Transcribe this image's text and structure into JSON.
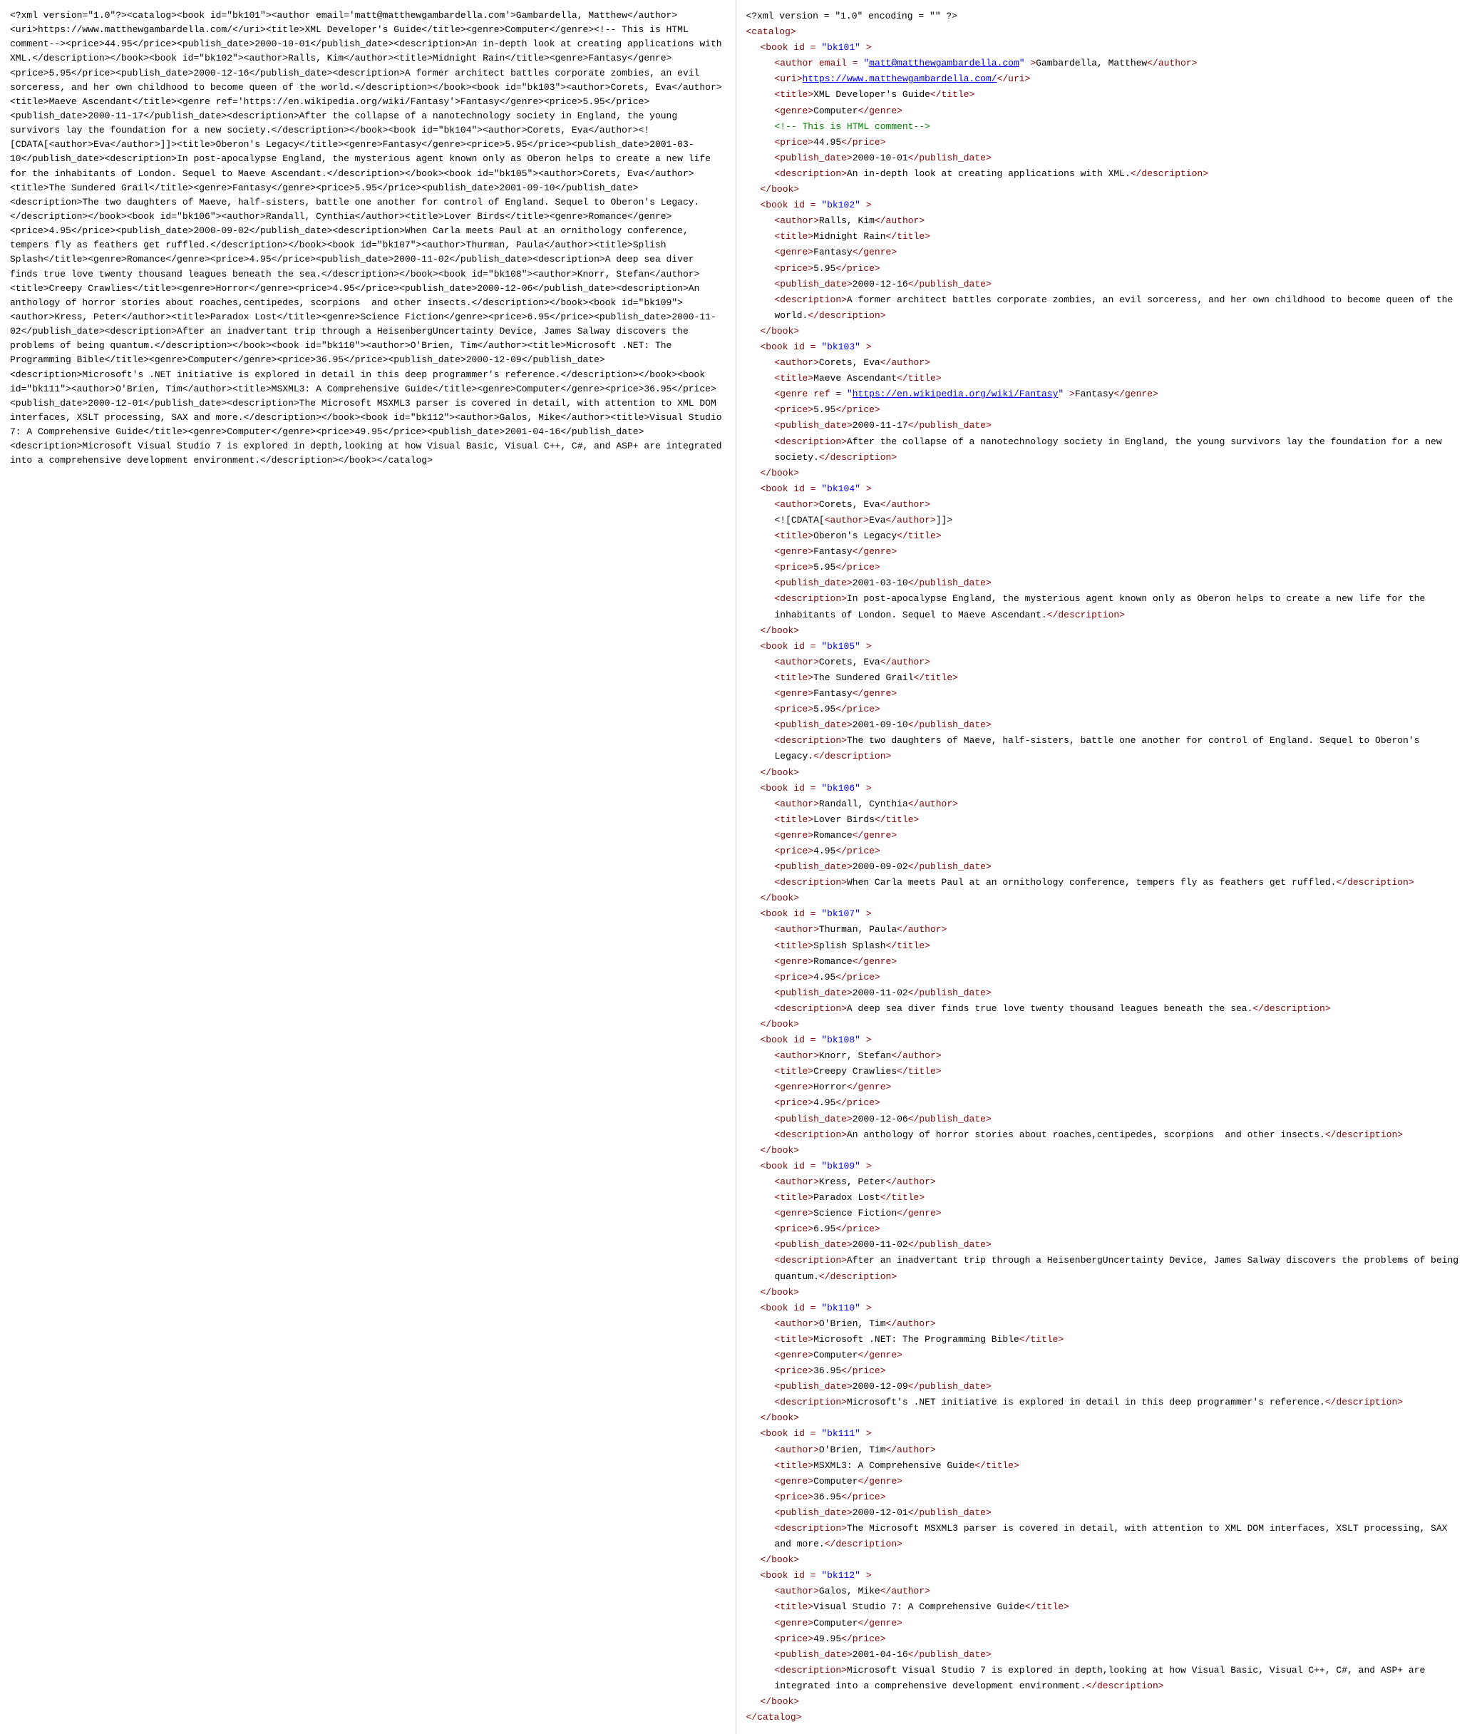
{
  "left_panel": {
    "content": "<?xml version=\"1.0\"?><catalog><book id=\"bk101\"><author email='matt@matthewgambardella.com'>Gambardella, Matthew</author><uri>https://www.matthewgambardella.com/</uri><title>XML Developer's Guide</title><genre>Computer</genre><!-- This is HTML comment--><price>44.95</price><publish_date>2000-10-01</publish_date><description>An in-depth look at creating applications with XML.</description></book><book id=\"bk102\"><author>Ralls, Kim</author><title>Midnight Rain</title><genre>Fantasy</genre><price>5.95</price><publish_date>2000-12-16</publish_date><description>A former architect battles corporate zombies, an evil sorceress, and her own childhood to become queen of the world.</description></book><book id=\"bk103\"><author>Corets, Eva</author><title>Maeve Ascendant</title><genre ref='https://en.wikipedia.org/wiki/Fantasy'>Fantasy</genre><price>5.95</price><publish_date>2000-11-17</publish_date><description>After the collapse of a nanotechnology society in England, the young survivors lay the foundation for a new society.</description></book><book id=\"bk104\"><author>Corets, Eva</author><![CDATA[<author>Eva</author>]]><title>Oberon's Legacy</title><genre>Fantasy</genre><price>5.95</price><publish_date>2001-03-10</publish_date><description>In post-apocalypse England, the mysterious agent known only as Oberon helps to create a new life for the inhabitants of London. Sequel to Maeve Ascendant.</description></book><book id=\"bk105\"><author>Corets, Eva</author><title>The Sundered Grail</title><genre>Fantasy</genre><price>5.95</price><publish_date>2001-09-10</publish_date><description>The two daughters of Maeve, half-sisters, battle one another for control of England. Sequel to Oberon's Legacy.</description></book><book id=\"bk106\"><author>Randall, Cynthia</author><title>Lover Birds</title><genre>Romance</genre><price>4.95</price><publish_date>2000-09-02</publish_date><description>When Carla meets Paul at an ornithology conference, tempers fly as feathers get ruffled.</description></book><book id=\"bk107\"><author>Thurman, Paula</author><title>Splish Splash</title><genre>Romance</genre><price>4.95</price><publish_date>2000-11-02</publish_date><description>A deep sea diver finds true love twenty thousand leagues beneath the sea.</description></book><book id=\"bk108\"><author>Knorr, Stefan</author><title>Creepy Crawlies</title><genre>Horror</genre><price>4.95</price><publish_date>2000-12-06</publish_date><description>An anthology of horror stories about roaches,centipedes, scorpions  and other insects.</description></book><book id=\"bk109\"><author>Kress, Peter</author><title>Paradox Lost</title><genre>Science Fiction</genre><price>6.95</price><publish_date>2000-11-02</publish_date><description>After an inadvertant trip through a HeisenbergUncertainty Device, James Salway discovers the problems of being quantum.</description></book><book id=\"bk110\"><author>O'Brien, Tim</author><title>Microsoft .NET: The Programming Bible</title><genre>Computer</genre><price>36.95</price><publish_date>2000-12-09</publish_date><description>Microsoft's .NET initiative is explored in detail in this deep programmer's reference.</description></book><book id=\"bk111\"><author>O'Brien, Tim</author><title>MSXML3: A Comprehensive Guide</title><genre>Computer</genre><price>36.95</price><publish_date>2000-12-01</publish_date><description>The Microsoft MSXML3 parser is covered in detail, with attention to XML DOM interfaces, XSLT processing, SAX and more.</description></book><book id=\"bk112\"><author>Galos, Mike</author><title>Visual Studio 7: A Comprehensive Guide</title><genre>Computer</genre><price>49.95</price><publish_date>2001-04-16</publish_date><description>Microsoft Visual Studio 7 is explored in depth,looking at how Visual Basic, Visual C++, C#, and ASP+ are integrated into a comprehensive development environment.</description></book></catalog>"
  },
  "right_panel": {
    "xml_declaration": "<?xml version = \"1.0\" encoding = \"\" ?>",
    "catalog_open": "<catalog>",
    "catalog_close": "</catalog>",
    "books": [
      {
        "id": "bk101",
        "author_email": "matt@matthewgambardella.com",
        "author_email_display": "matt@matthewgambardella.com",
        "author_name": "Gambardella, Matthew",
        "uri": "https://www.matthewgambardella.com/",
        "title": "XML Developer's Guide",
        "genre": "Computer",
        "comment": "<!-- This is HTML comment-->",
        "price": "44.95",
        "publish_date": "2000-10-01",
        "description": "An in-depth look at creating applications with XML."
      },
      {
        "id": "bk102",
        "author_name": "Ralls, Kim",
        "title": "Midnight Rain",
        "genre": "Fantasy",
        "price": "5.95",
        "publish_date": "2000-12-16",
        "description": "A former architect battles corporate zombies, an evil sorceress, and her own childhood to become queen of the world."
      },
      {
        "id": "bk103",
        "author_name": "Corets, Eva",
        "title": "Maeve Ascendant",
        "genre_ref": "https://en.wikipedia.org/wiki/Fantasy",
        "genre": "Fantasy",
        "price": "5.95",
        "publish_date": "2000-11-17",
        "description": "After the collapse of a nanotechnology society in England, the young survivors lay the foundation for a new society."
      },
      {
        "id": "bk104",
        "author_name": "Corets, Eva",
        "cdata": "<![CDATA[<author>Eva</author>]]>",
        "title": "Oberon's Legacy",
        "genre": "Fantasy",
        "price": "5.95",
        "publish_date": "2001-03-10",
        "description": "In post-apocalypse England, the mysterious agent known only as Oberon helps to create a new life for the inhabitants of London. Sequel to Maeve Ascendant."
      },
      {
        "id": "bk105",
        "author_name": "Corets, Eva",
        "title": "The Sundered Grail",
        "genre": "Fantasy",
        "price": "5.95",
        "publish_date": "2001-09-10",
        "description": "The two daughters of Maeve, half-sisters, battle one another for control of England. Sequel to Oberon's Legacy."
      },
      {
        "id": "bk106",
        "author_name": "Randall, Cynthia",
        "title": "Lover Birds",
        "genre": "Romance",
        "price": "4.95",
        "publish_date": "2000-09-02",
        "description": "When Carla meets Paul at an ornithology conference, tempers fly as feathers get ruffled."
      },
      {
        "id": "bk107",
        "author_name": "Thurman, Paula",
        "title": "Splish Splash",
        "genre": "Romance",
        "price": "4.95",
        "publish_date": "2000-11-02",
        "description": "A deep sea diver finds true love twenty thousand leagues beneath the sea."
      },
      {
        "id": "bk108",
        "author_name": "Knorr, Stefan",
        "title": "Creepy Crawlies",
        "genre": "Horror",
        "price": "4.95",
        "publish_date": "2000-12-06",
        "description": "An anthology of horror stories about roaches,centipedes, scorpions  and other insects."
      },
      {
        "id": "bk109",
        "author_name": "Kress, Peter",
        "title": "Paradox Lost",
        "genre": "Science Fiction",
        "price": "6.95",
        "publish_date": "2000-11-02",
        "description": "After an inadvertant trip through a HeisenbergUncertainty Device, James Salway discovers the problems of being quantum."
      },
      {
        "id": "bk110",
        "author_name": "O'Brien, Tim",
        "title": "Microsoft .NET: The Programming Bible",
        "genre": "Computer",
        "price": "36.95",
        "publish_date": "2000-12-09",
        "description": "Microsoft's .NET initiative is explored in detail in this deep programmer's reference."
      },
      {
        "id": "bk111",
        "author_name": "O'Brien, Tim",
        "title": "MSXML3: A Comprehensive Guide",
        "genre": "Computer",
        "price": "36.95",
        "publish_date": "2000-12-01",
        "description": "The Microsoft MSXML3 parser is covered in detail, with attention to XML DOM interfaces, XSLT processing, SAX and more."
      },
      {
        "id": "bk112",
        "author_name": "Galos, Mike",
        "title": "Visual Studio 7: A Comprehensive Guide",
        "genre": "Computer",
        "price": "49.95",
        "publish_date": "2001-04-16",
        "description": "Microsoft Visual Studio 7 is explored in depth,looking at how Visual Basic, Visual C++, C#, and ASP+ are integrated into a comprehensive development environment."
      }
    ]
  }
}
